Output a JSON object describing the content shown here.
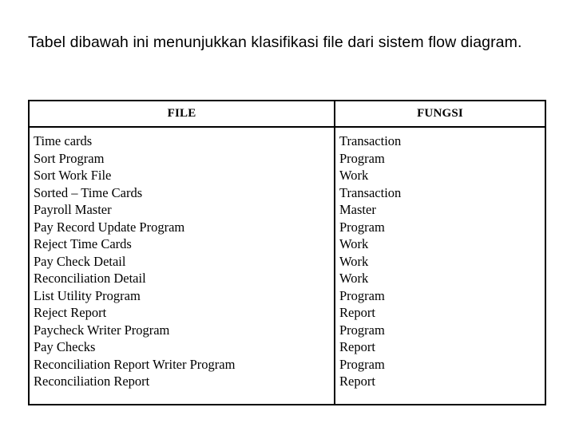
{
  "heading": {
    "text": "Tabel dibawah ini menunjukkan klasifikasi file dari sistem flow diagram."
  },
  "table": {
    "headers": {
      "file": "FILE",
      "fungsi": "FUNGSI"
    },
    "rows": [
      {
        "file": "Time cards",
        "fungsi": "Transaction"
      },
      {
        "file": "Sort Program",
        "fungsi": "Program"
      },
      {
        "file": "Sort Work File",
        "fungsi": "Work"
      },
      {
        "file": "Sorted – Time Cards",
        "fungsi": "Transaction"
      },
      {
        "file": "Payroll Master",
        "fungsi": "Master"
      },
      {
        "file": "Pay Record Update Program",
        "fungsi": "Program"
      },
      {
        "file": "Reject Time Cards",
        "fungsi": "Work"
      },
      {
        "file": "Pay Check Detail",
        "fungsi": "Work"
      },
      {
        "file": "Reconciliation Detail",
        "fungsi": "Work"
      },
      {
        "file": "List Utility Program",
        "fungsi": "Program"
      },
      {
        "file": "Reject Report",
        "fungsi": "Report"
      },
      {
        "file": "Paycheck Writer Program",
        "fungsi": "Program"
      },
      {
        "file": "Pay Checks",
        "fungsi": "Report"
      },
      {
        "file": "Reconciliation Report Writer Program",
        "fungsi": "Program"
      },
      {
        "file": "Reconciliation Report",
        "fungsi": "Report"
      }
    ]
  },
  "colors": {
    "background": "#ffffff",
    "text": "#000000",
    "border": "#000000"
  }
}
